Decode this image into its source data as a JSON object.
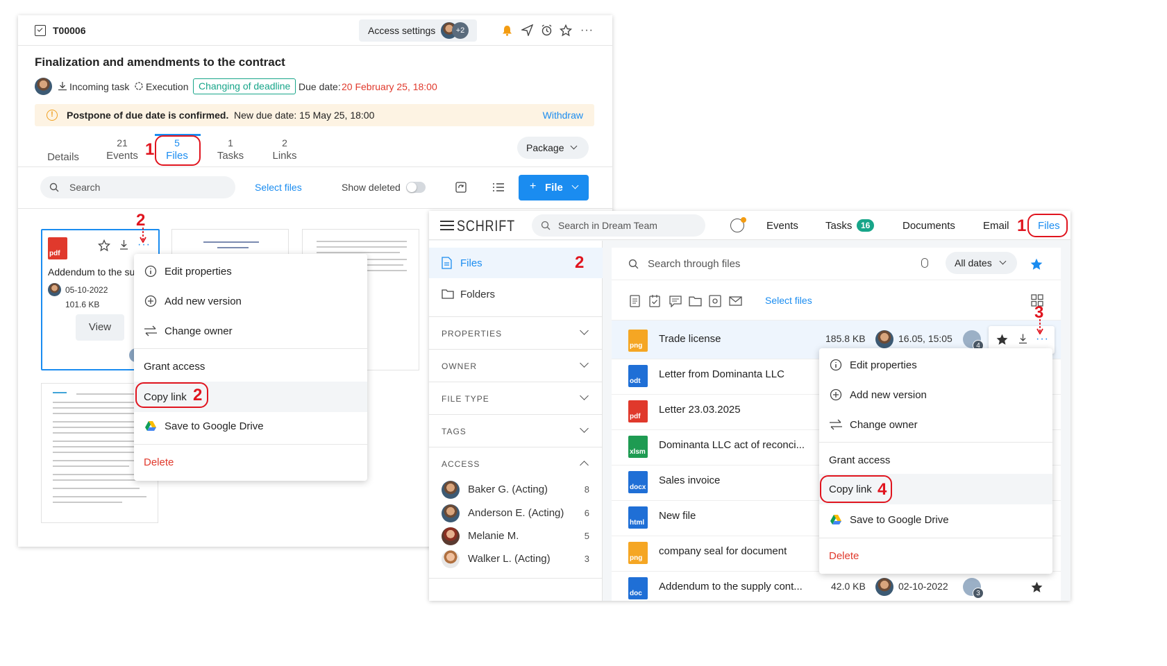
{
  "task": {
    "id": "T00006",
    "access_button": "Access settings",
    "access_extra": "+2",
    "title": "Finalization and amendments to the contract",
    "incoming": "Incoming task",
    "execution": "Execution",
    "badge": "Changing of deadline",
    "due_label": "Due date:",
    "due_value": "20 February 25, 18:00",
    "banner_bold": "Postpone of due date is confirmed.",
    "banner_rest": "New due date: 15 May 25, 18:00",
    "withdraw": "Withdraw",
    "tabs": [
      {
        "count": "",
        "label": "Details"
      },
      {
        "count": "21",
        "label": "Events"
      },
      {
        "count": "5",
        "label": "Files"
      },
      {
        "count": "1",
        "label": "Tasks"
      },
      {
        "count": "2",
        "label": "Links"
      }
    ],
    "package": "Package",
    "search_placeholder": "Search",
    "select_files": "Select files",
    "show_deleted": "Show deleted",
    "file_button": "File",
    "card": {
      "type": "pdf",
      "name": "Addendum to the sup",
      "date": "05-10-2022",
      "size": "101.6 KB",
      "view": "View"
    }
  },
  "menu_left": {
    "items": [
      "Edit properties",
      "Add new version",
      "Change owner",
      "Grant access",
      "Copy link",
      "Save to Google Drive",
      "Delete"
    ]
  },
  "schrift": {
    "logo": "SCHRIFT",
    "search_placeholder": "Search in Dream Team",
    "nav": {
      "events": "Events",
      "tasks": "Tasks",
      "tasks_count": "16",
      "documents": "Documents",
      "email": "Email",
      "files": "Files"
    },
    "sidebar": {
      "files": "Files",
      "folders": "Folders",
      "sections": [
        "PROPERTIES",
        "OWNER",
        "FILE TYPE",
        "TAGS",
        "ACCESS"
      ],
      "access": [
        {
          "name": "Baker G. (Acting)",
          "count": "8"
        },
        {
          "name": "Anderson E. (Acting)",
          "count": "6"
        },
        {
          "name": "Melanie M.",
          "count": "5"
        },
        {
          "name": "Walker L. (Acting)",
          "count": "3"
        }
      ]
    },
    "files_search_placeholder": "Search through files",
    "all_dates": "All dates",
    "select_files": "Select files",
    "files": [
      {
        "type": "png",
        "color": "#f5a623",
        "name": "Trade license",
        "size": "185.8 KB",
        "date": "16.05, 15:05",
        "count": "4"
      },
      {
        "type": "odt",
        "color": "#1f6fd6",
        "name": "Letter from Dominanta LLC"
      },
      {
        "type": "pdf",
        "color": "#e0392c",
        "name": "Letter 23.03.2025"
      },
      {
        "type": "xlsm",
        "color": "#1e9b52",
        "name": "Dominanta LLC act of reconci..."
      },
      {
        "type": "docx",
        "color": "#1f6fd6",
        "name": "Sales invoice"
      },
      {
        "type": "html",
        "color": "#1f6fd6",
        "name": "New file"
      },
      {
        "type": "png",
        "color": "#f5a623",
        "name": "company seal for document"
      },
      {
        "type": "doc",
        "color": "#1f6fd6",
        "name": "Addendum to the supply cont...",
        "size": "42.0 KB",
        "date": "02-10-2022",
        "count": "3"
      }
    ]
  },
  "menu_right": {
    "items": [
      "Edit properties",
      "Add new version",
      "Change owner",
      "Grant access",
      "Copy link",
      "Save to Google Drive",
      "Delete"
    ]
  },
  "annotations": {
    "n1": "1",
    "n2": "2",
    "n3": "3",
    "n4": "4"
  },
  "colors": {
    "accent": "#1a8cf0",
    "red": "#e0141e",
    "teal": "#17a589",
    "banner": "#fdf3e3"
  }
}
